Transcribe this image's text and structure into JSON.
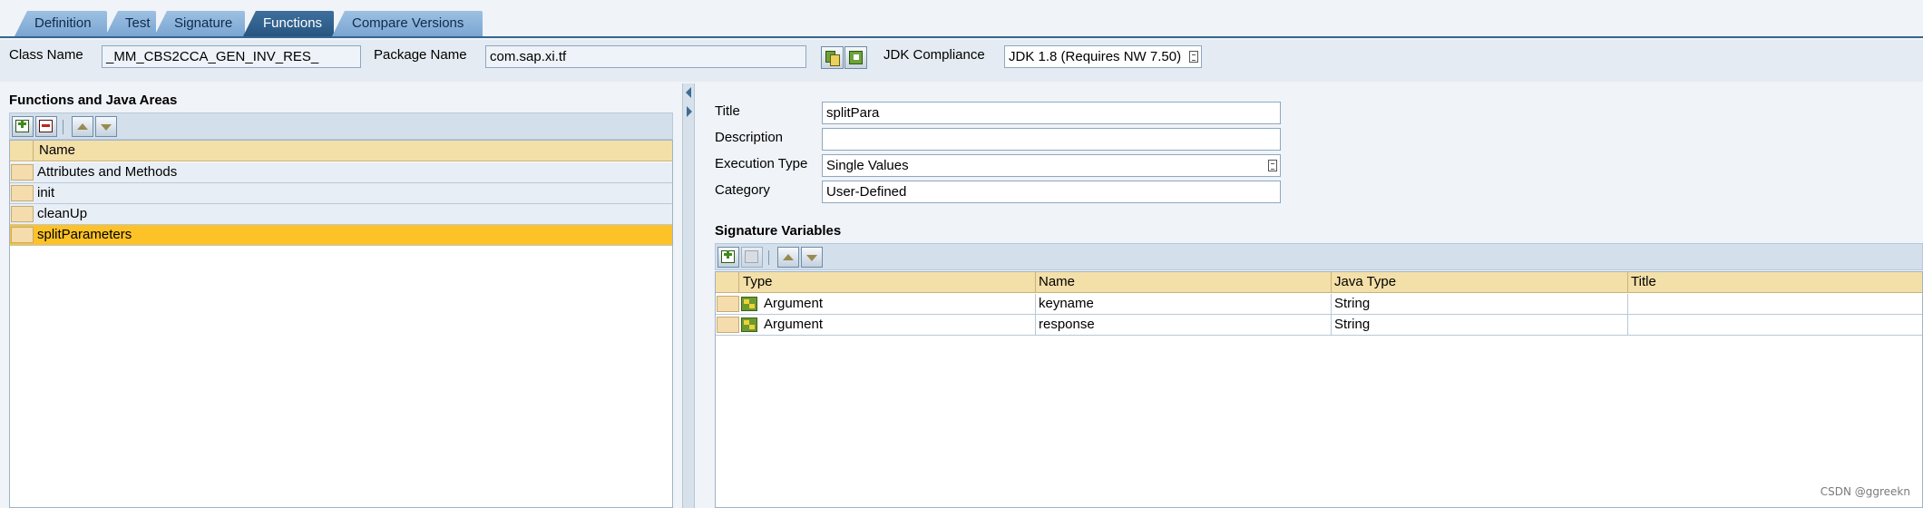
{
  "tabs": [
    {
      "label": "Definition",
      "active": false
    },
    {
      "label": "Test",
      "active": false
    },
    {
      "label": "Signature",
      "active": false
    },
    {
      "label": "Functions",
      "active": true
    },
    {
      "label": "Compare Versions",
      "active": false
    }
  ],
  "header": {
    "class_name_label": "Class Name",
    "class_name_value": "_MM_CBS2CCA_GEN_INV_RES_",
    "package_name_label": "Package Name",
    "package_name_value": "com.sap.xi.tf",
    "jdk_label": "JDK Compliance",
    "jdk_value": "JDK 1.8 (Requires NW 7.50)"
  },
  "left": {
    "title": "Functions and Java Areas",
    "column_header": "Name",
    "rows": [
      {
        "name": "Attributes and Methods",
        "selected": false
      },
      {
        "name": "init",
        "selected": false
      },
      {
        "name": "cleanUp",
        "selected": false
      },
      {
        "name": "splitParameters",
        "selected": true
      }
    ]
  },
  "right": {
    "title_label": "Title",
    "title_value": "splitPara",
    "description_label": "Description",
    "description_value": "",
    "exec_type_label": "Execution Type",
    "exec_type_value": "Single Values",
    "category_label": "Category",
    "category_value": "User-Defined",
    "sigvars_title": "Signature Variables",
    "columns": [
      "Type",
      "Name",
      "Java Type",
      "Title"
    ],
    "rows": [
      {
        "type": "Argument",
        "name": "keyname",
        "java_type": "String",
        "title": ""
      },
      {
        "type": "Argument",
        "name": "response",
        "java_type": "String",
        "title": ""
      }
    ]
  },
  "watermark": "CSDN @ggreekn",
  "colors": {
    "active_tab": "#275580",
    "inactive_tab": "#8fb5dc",
    "selected_row": "#fcc227",
    "grid_header": "#f3dfa8"
  }
}
